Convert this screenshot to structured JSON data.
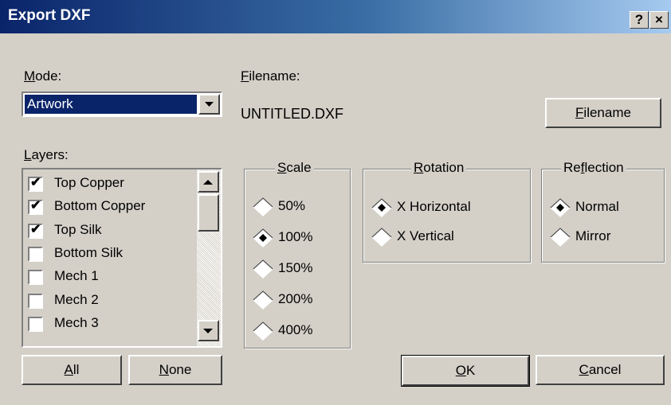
{
  "window": {
    "title": "Export DXF",
    "help_label": "?",
    "close_label": "×"
  },
  "mode": {
    "label_underline": "M",
    "label_rest": "ode:",
    "selected": "Artwork"
  },
  "filename": {
    "label_underline": "F",
    "label_rest": "ilename:",
    "value": "UNTITLED.DXF",
    "button_underline": "F",
    "button_rest": "ilename"
  },
  "layers": {
    "label_underline": "L",
    "label_rest": "ayers:",
    "items": [
      {
        "label": "Top Copper",
        "checked": true
      },
      {
        "label": "Bottom Copper",
        "checked": true
      },
      {
        "label": "Top Silk",
        "checked": true
      },
      {
        "label": "Bottom Silk",
        "checked": false
      },
      {
        "label": "Mech 1",
        "checked": false
      },
      {
        "label": "Mech 2",
        "checked": false
      },
      {
        "label": "Mech 3",
        "checked": false
      }
    ],
    "all_underline": "A",
    "all_rest": "ll",
    "none_underline": "N",
    "none_rest": "one"
  },
  "scale": {
    "title_underline": "S",
    "title_rest": "cale",
    "options": [
      "50%",
      "100%",
      "150%",
      "200%",
      "400%"
    ],
    "selected": "100%"
  },
  "rotation": {
    "title_underline": "R",
    "title_rest": "otation",
    "options": [
      "X Horizontal",
      "X Vertical"
    ],
    "selected": "X Horizontal"
  },
  "reflection": {
    "title_pre": "Re",
    "title_underline": "f",
    "title_rest": "lection",
    "options": [
      "Normal",
      "Mirror"
    ],
    "selected": "Normal"
  },
  "buttons": {
    "ok_underline": "O",
    "ok_rest": "K",
    "cancel_underline": "C",
    "cancel_rest": "ancel"
  },
  "colors": {
    "face": "#d4d0c8",
    "title_start": "#0a246a",
    "title_end": "#a6caf0",
    "selection": "#0a246a"
  }
}
